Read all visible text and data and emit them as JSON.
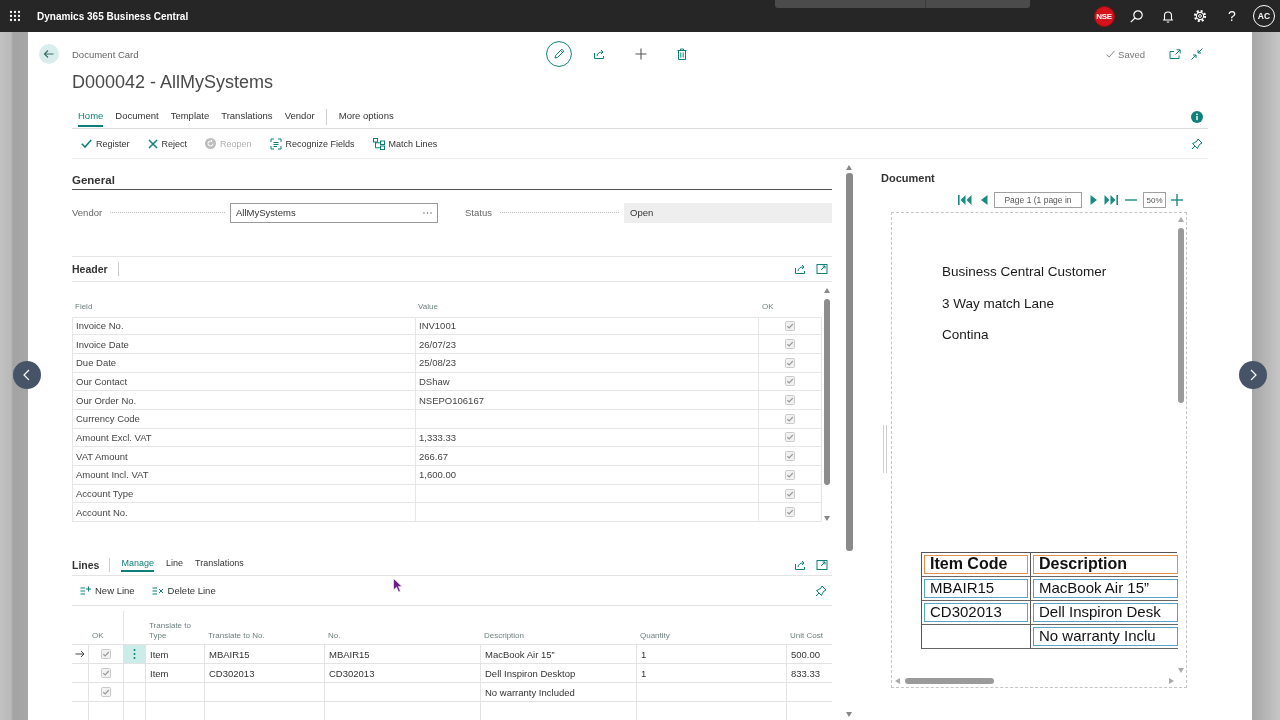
{
  "top_bar": {
    "app_name": "Dynamics 365 Business Central",
    "company_badge": "NSE",
    "help": "?",
    "avatar": "AC"
  },
  "page": {
    "breadcrumb": "Document Card",
    "title": "D000042 - AllMySystems",
    "save_status": "Saved"
  },
  "tabs": [
    {
      "label": "Home",
      "selected": true
    },
    {
      "label": "Document",
      "selected": false
    },
    {
      "label": "Template",
      "selected": false
    },
    {
      "label": "Translations",
      "selected": false
    },
    {
      "label": "Vendor",
      "selected": false
    }
  ],
  "more_options": "More options",
  "actions": [
    {
      "kind": "register",
      "label": "Register",
      "disabled": false
    },
    {
      "kind": "reject",
      "label": "Reject",
      "disabled": false
    },
    {
      "kind": "reopen",
      "label": "Reopen",
      "disabled": true
    },
    {
      "kind": "recognize",
      "label": "Recognize Fields",
      "disabled": false
    },
    {
      "kind": "match",
      "label": "Match Lines",
      "disabled": false
    }
  ],
  "general": {
    "title": "General",
    "fields": [
      {
        "kind": "lookup",
        "label": "Vendor",
        "value": "AllMySystems"
      },
      {
        "kind": "readonly",
        "label": "Status",
        "value": "Open"
      }
    ]
  },
  "header_part": {
    "title": "Header",
    "columns": [
      "Field",
      "Value",
      "OK"
    ],
    "rows": [
      {
        "field": "Invoice No.",
        "value": "INV1001",
        "checked": true
      },
      {
        "field": "Invoice Date",
        "value": "26/07/23",
        "checked": true
      },
      {
        "field": "Due Date",
        "value": "25/08/23",
        "checked": true
      },
      {
        "field": "Our Contact",
        "value": "DShaw",
        "checked": true
      },
      {
        "field": "Our Order No.",
        "value": "NSEPO106167",
        "checked": true
      },
      {
        "field": "Currency Code",
        "checked": true
      },
      {
        "field": "Amount Excl. VAT",
        "value": "1,333.33",
        "checked": true
      },
      {
        "field": "VAT Amount",
        "value": "266.67",
        "checked": true
      },
      {
        "field": "Amount Incl. VAT",
        "value": "1,600.00",
        "checked": true
      },
      {
        "field": "Account Type",
        "checked": true
      },
      {
        "field": "Account No.",
        "checked": true
      }
    ]
  },
  "lines_part": {
    "title": "Lines",
    "tabs": [
      {
        "label": "Manage",
        "selected": true
      },
      {
        "label": "Line",
        "selected": false
      },
      {
        "label": "Translations",
        "selected": false
      }
    ],
    "actions": [
      {
        "kind": "new",
        "label": "New Line"
      },
      {
        "kind": "delete",
        "label": "Delete Line"
      }
    ],
    "columns": [
      "OK",
      "Translate to Type",
      "Translate to No.",
      "No.",
      "Description",
      "Quantity",
      "Unit Cost"
    ],
    "rows": [
      {
        "selected": true,
        "checked": true,
        "type": "Item",
        "translate_to_no": "MBAIR15",
        "no": "MBAIR15",
        "description": "MacBook Air 15”",
        "quantity": "1",
        "unit_cost": "500.00"
      },
      {
        "selected": false,
        "checked": true,
        "type": "Item",
        "translate_to_no": "CD302013",
        "no": "CD302013",
        "description": "Dell Inspiron Desktop",
        "quantity": "1",
        "unit_cost": "833.33"
      },
      {
        "selected": false,
        "checked": true,
        "description": "No warranty Included"
      }
    ]
  },
  "document_pane": {
    "title": "Document",
    "page_field": "Page 1 (1 page in",
    "zoom_field": "50%",
    "preview": {
      "address_lines": [
        "Business Central Customer",
        "3 Way match Lane",
        "Contina"
      ],
      "columns": [
        "Item Code",
        "Description"
      ],
      "rows": [
        {
          "item_code": "MBAIR15",
          "description": "MacBook Air 15”"
        },
        {
          "item_code": "CD302013",
          "description": "Dell Inspiron Desk"
        },
        {
          "description": "No warranty Inclu"
        }
      ]
    }
  }
}
